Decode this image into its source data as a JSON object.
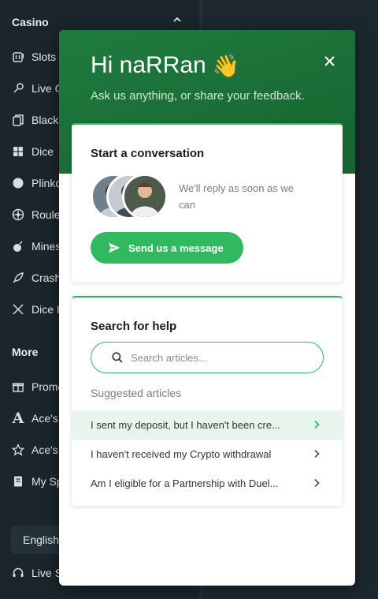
{
  "sidebar": {
    "casino_heading": "Casino",
    "more_heading": "More",
    "casino_items": [
      {
        "label": "Slots",
        "icon": "slot-machine-icon"
      },
      {
        "label": "Live G",
        "icon": "microphone-icon"
      },
      {
        "label": "Black",
        "icon": "cards-icon"
      },
      {
        "label": "Dice",
        "icon": "dice-icon"
      },
      {
        "label": "Plinko",
        "icon": "plinko-ball-icon"
      },
      {
        "label": "Roule",
        "icon": "roulette-icon"
      },
      {
        "label": "Mines",
        "icon": "bomb-icon"
      },
      {
        "label": "Crash",
        "icon": "rocket-icon"
      },
      {
        "label": "Dice I",
        "icon": "swords-icon"
      }
    ],
    "more_items": [
      {
        "label": "Promo",
        "icon": "gift-icon"
      },
      {
        "label": "Ace's",
        "icon": "letter-a-icon"
      },
      {
        "label": "Ace's",
        "icon": "star-icon"
      },
      {
        "label": "My Sp",
        "icon": "document-icon"
      }
    ],
    "language": "English",
    "live_support": "Live S"
  },
  "widget": {
    "greeting": "Hi naRRan",
    "wave_emoji": "👋",
    "subtitle": "Ask us anything, or share your feedback.",
    "conversation": {
      "title": "Start a conversation",
      "reply_text": "We'll reply as soon as we can",
      "send_label": "Send us a message"
    },
    "help": {
      "title": "Search for help",
      "search_placeholder": "Search articles...",
      "suggested_label": "Suggested articles",
      "articles": [
        "I sent my deposit, but I haven't been cre...",
        "I haven't received my Crypto withdrawal",
        "Am I eligible for a Partnership with Duel..."
      ]
    }
  },
  "colors": {
    "accent_green": "#30b95f",
    "header_green": "#1f7c3e",
    "sidebar_bg": "#1b252b"
  }
}
